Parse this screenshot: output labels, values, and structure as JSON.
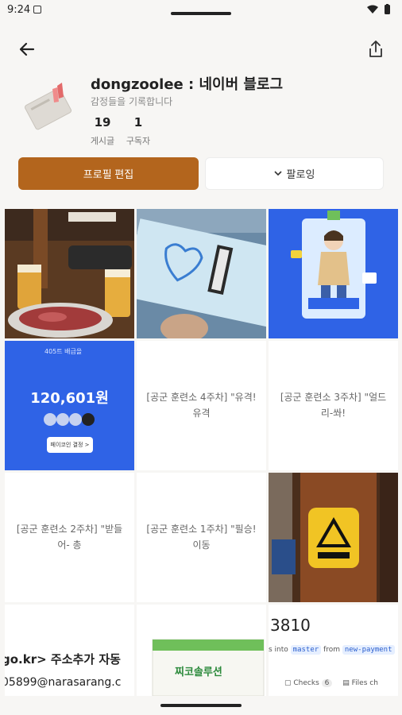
{
  "status_bar": {
    "time": "9:24"
  },
  "profile": {
    "title": "dongzoolee : 네이버 블로그",
    "description": "감정들을 기록합니다",
    "posts_count": "19",
    "posts_label": "게시글",
    "subscribers_count": "1",
    "subscribers_label": "구독자"
  },
  "actions": {
    "edit_label": "프로필 편집",
    "follow_label": "팔로잉"
  },
  "posts": [
    {
      "type": "image",
      "icon": "bbq-dinner-photo"
    },
    {
      "type": "image",
      "icon": "boarding-pass-photo"
    },
    {
      "type": "image",
      "icon": "illustrated-character-card"
    },
    {
      "type": "image",
      "icon": "payment-card",
      "badge": "405트 배급을",
      "amount": "120,601원",
      "button": "페이코인 결정 >"
    },
    {
      "type": "text",
      "text": "[공군 훈련소 4주차] \"유격! 유격"
    },
    {
      "type": "text",
      "text": "[공군 훈련소 3주차] \"얼드리-쏴!"
    },
    {
      "type": "text",
      "text": "[공군 훈련소 2주차] \"받들어- 총"
    },
    {
      "type": "text",
      "text": "[공군 훈련소 1주차] \"필승! 이동"
    },
    {
      "type": "image",
      "icon": "caution-sign-photo"
    },
    {
      "type": "image",
      "icon": "address-screenshot",
      "line1": "go.kr>  주소추가  자동",
      "line2": "05899@narasarang.c"
    },
    {
      "type": "image",
      "icon": "product-box-photo",
      "product": "찌코솔루션"
    },
    {
      "type": "image",
      "icon": "code-review-screenshot",
      "number": "3810",
      "into": "s into",
      "branch1": "master",
      "from": "from",
      "branch2": "new-payment",
      "checks": "Checks",
      "checks_count": "6",
      "files": "Files ch"
    }
  ],
  "colors": {
    "accent": "#b3651d",
    "background": "#f7f6f4",
    "blue_tile": "#2f63e6"
  }
}
